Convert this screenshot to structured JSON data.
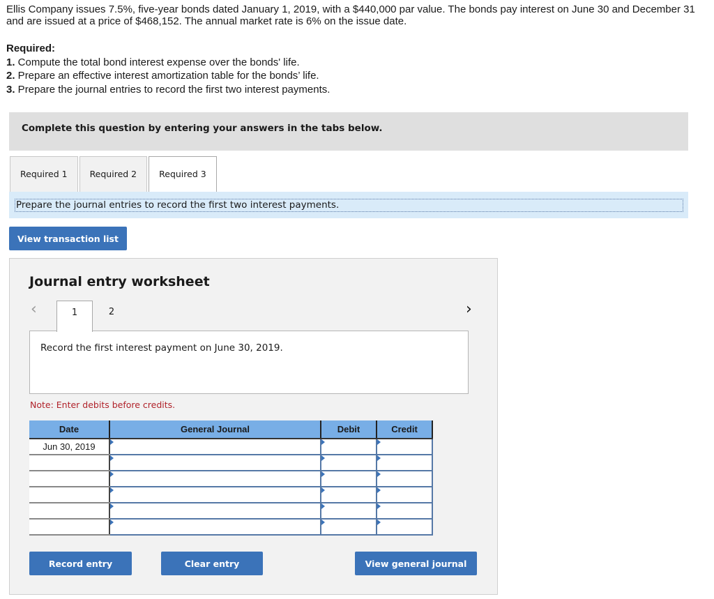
{
  "problem": {
    "intro": "Ellis Company issues 7.5%, five-year bonds dated January 1, 2019, with a $440,000 par value. The bonds pay interest on June 30 and December 31 and are issued at a price of $468,152. The annual market rate is 6% on the issue date.",
    "required_heading": "Required:",
    "requirements": [
      {
        "num": "1.",
        "text": " Compute the total bond interest expense over the bonds' life."
      },
      {
        "num": "2.",
        "text": " Prepare an effective interest amortization table for the bonds’ life."
      },
      {
        "num": "3.",
        "text": " Prepare the journal entries to record the first two interest payments."
      }
    ]
  },
  "complete_banner": "Complete this question by entering your answers in the tabs below.",
  "tabs": [
    {
      "label": "Required 1",
      "active": false
    },
    {
      "label": "Required 2",
      "active": false
    },
    {
      "label": "Required 3",
      "active": true
    }
  ],
  "instruction": "Prepare the journal entries to record the first two interest payments.",
  "buttons": {
    "view_transaction_list": "View transaction list",
    "record_entry": "Record entry",
    "clear_entry": "Clear entry",
    "view_general_journal": "View general journal"
  },
  "worksheet": {
    "title": "Journal entry worksheet",
    "prev_icon": "‹",
    "next_icon": "›",
    "pages": [
      "1",
      "2"
    ],
    "current_page": "1",
    "record_text": "Record the first interest payment on June 30, 2019.",
    "note": "Note: Enter debits before credits.",
    "columns": [
      "Date",
      "General Journal",
      "Debit",
      "Credit"
    ],
    "rows": [
      {
        "date": "Jun 30, 2019",
        "general_journal": "",
        "debit": "",
        "credit": ""
      },
      {
        "date": "",
        "general_journal": "",
        "debit": "",
        "credit": ""
      },
      {
        "date": "",
        "general_journal": "",
        "debit": "",
        "credit": ""
      },
      {
        "date": "",
        "general_journal": "",
        "debit": "",
        "credit": ""
      },
      {
        "date": "",
        "general_journal": "",
        "debit": "",
        "credit": ""
      },
      {
        "date": "",
        "general_journal": "",
        "debit": "",
        "credit": ""
      }
    ]
  },
  "colors": {
    "button_blue": "#3b73b9",
    "header_blue": "#78aee6",
    "note_red": "#b0222a",
    "instruction_bg": "#d9ebf9"
  }
}
